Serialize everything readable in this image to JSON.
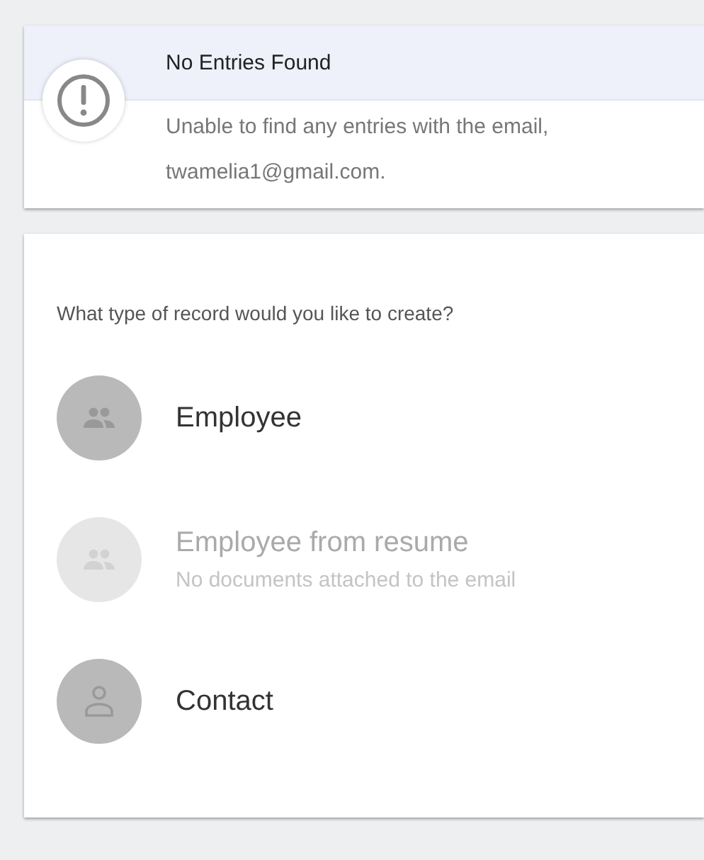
{
  "notice": {
    "title": "No Entries Found",
    "message_lines": [
      "Unable to find any entries with the email,",
      "twamelia1@gmail.com."
    ]
  },
  "create": {
    "prompt": "What type of record would you like to create?",
    "options": [
      {
        "kind": "group",
        "label": "Employee",
        "disabled": false
      },
      {
        "kind": "group",
        "label": "Employee from resume",
        "subtitle": "No documents attached to the email",
        "disabled": true
      },
      {
        "kind": "person",
        "label": "Contact",
        "disabled": false
      }
    ]
  }
}
